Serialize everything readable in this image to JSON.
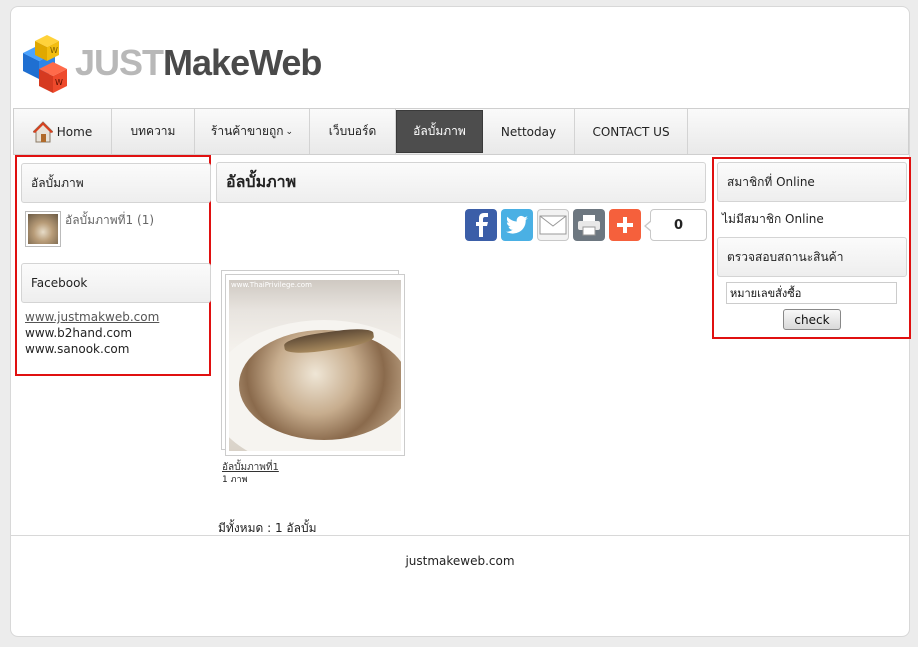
{
  "header": {
    "brand_just": "JUST",
    "brand_rest": "MakeWeb"
  },
  "nav": [
    {
      "label": "Home",
      "icon": "home-icon"
    },
    {
      "label": "บทความ"
    },
    {
      "label": "ร้านค้าขายถูก",
      "caret": "⌄"
    },
    {
      "label": "เว็บบอร์ด"
    },
    {
      "label": "อัลบั้มภาพ",
      "active": true
    },
    {
      "label": "Nettoday"
    },
    {
      "label": "CONTACT US"
    }
  ],
  "left": {
    "album_title": "อัลบั้มภาพ",
    "album_link": "อัลบั้มภาพที่1 (1)",
    "facebook_title": "Facebook",
    "links": [
      "www.justmakweb.com",
      "www.b2hand.com",
      "www.sanook.com"
    ]
  },
  "center": {
    "title": "อัลบั้มภาพ",
    "share_count": "0",
    "photo_watermark": "www.ThaiPrivilege.com",
    "album_name": "อัลบั้มภาพที่1",
    "album_count": "1 ภาพ",
    "total": "มีทั้งหมด : 1 อัลบั้ม"
  },
  "right": {
    "online_title": "สมาชิกที่ Online",
    "online_text": "ไม่มีสมาชิก Online",
    "check_title": "ตรวจสอบสถานะสินค้า",
    "order_value": "หมายเลขสั่งซื้อ",
    "check_label": "check"
  },
  "footer": {
    "text": "justmakeweb.com"
  },
  "colors": {
    "frame_red": "#e01010",
    "nav_active": "#4d4d4d"
  }
}
